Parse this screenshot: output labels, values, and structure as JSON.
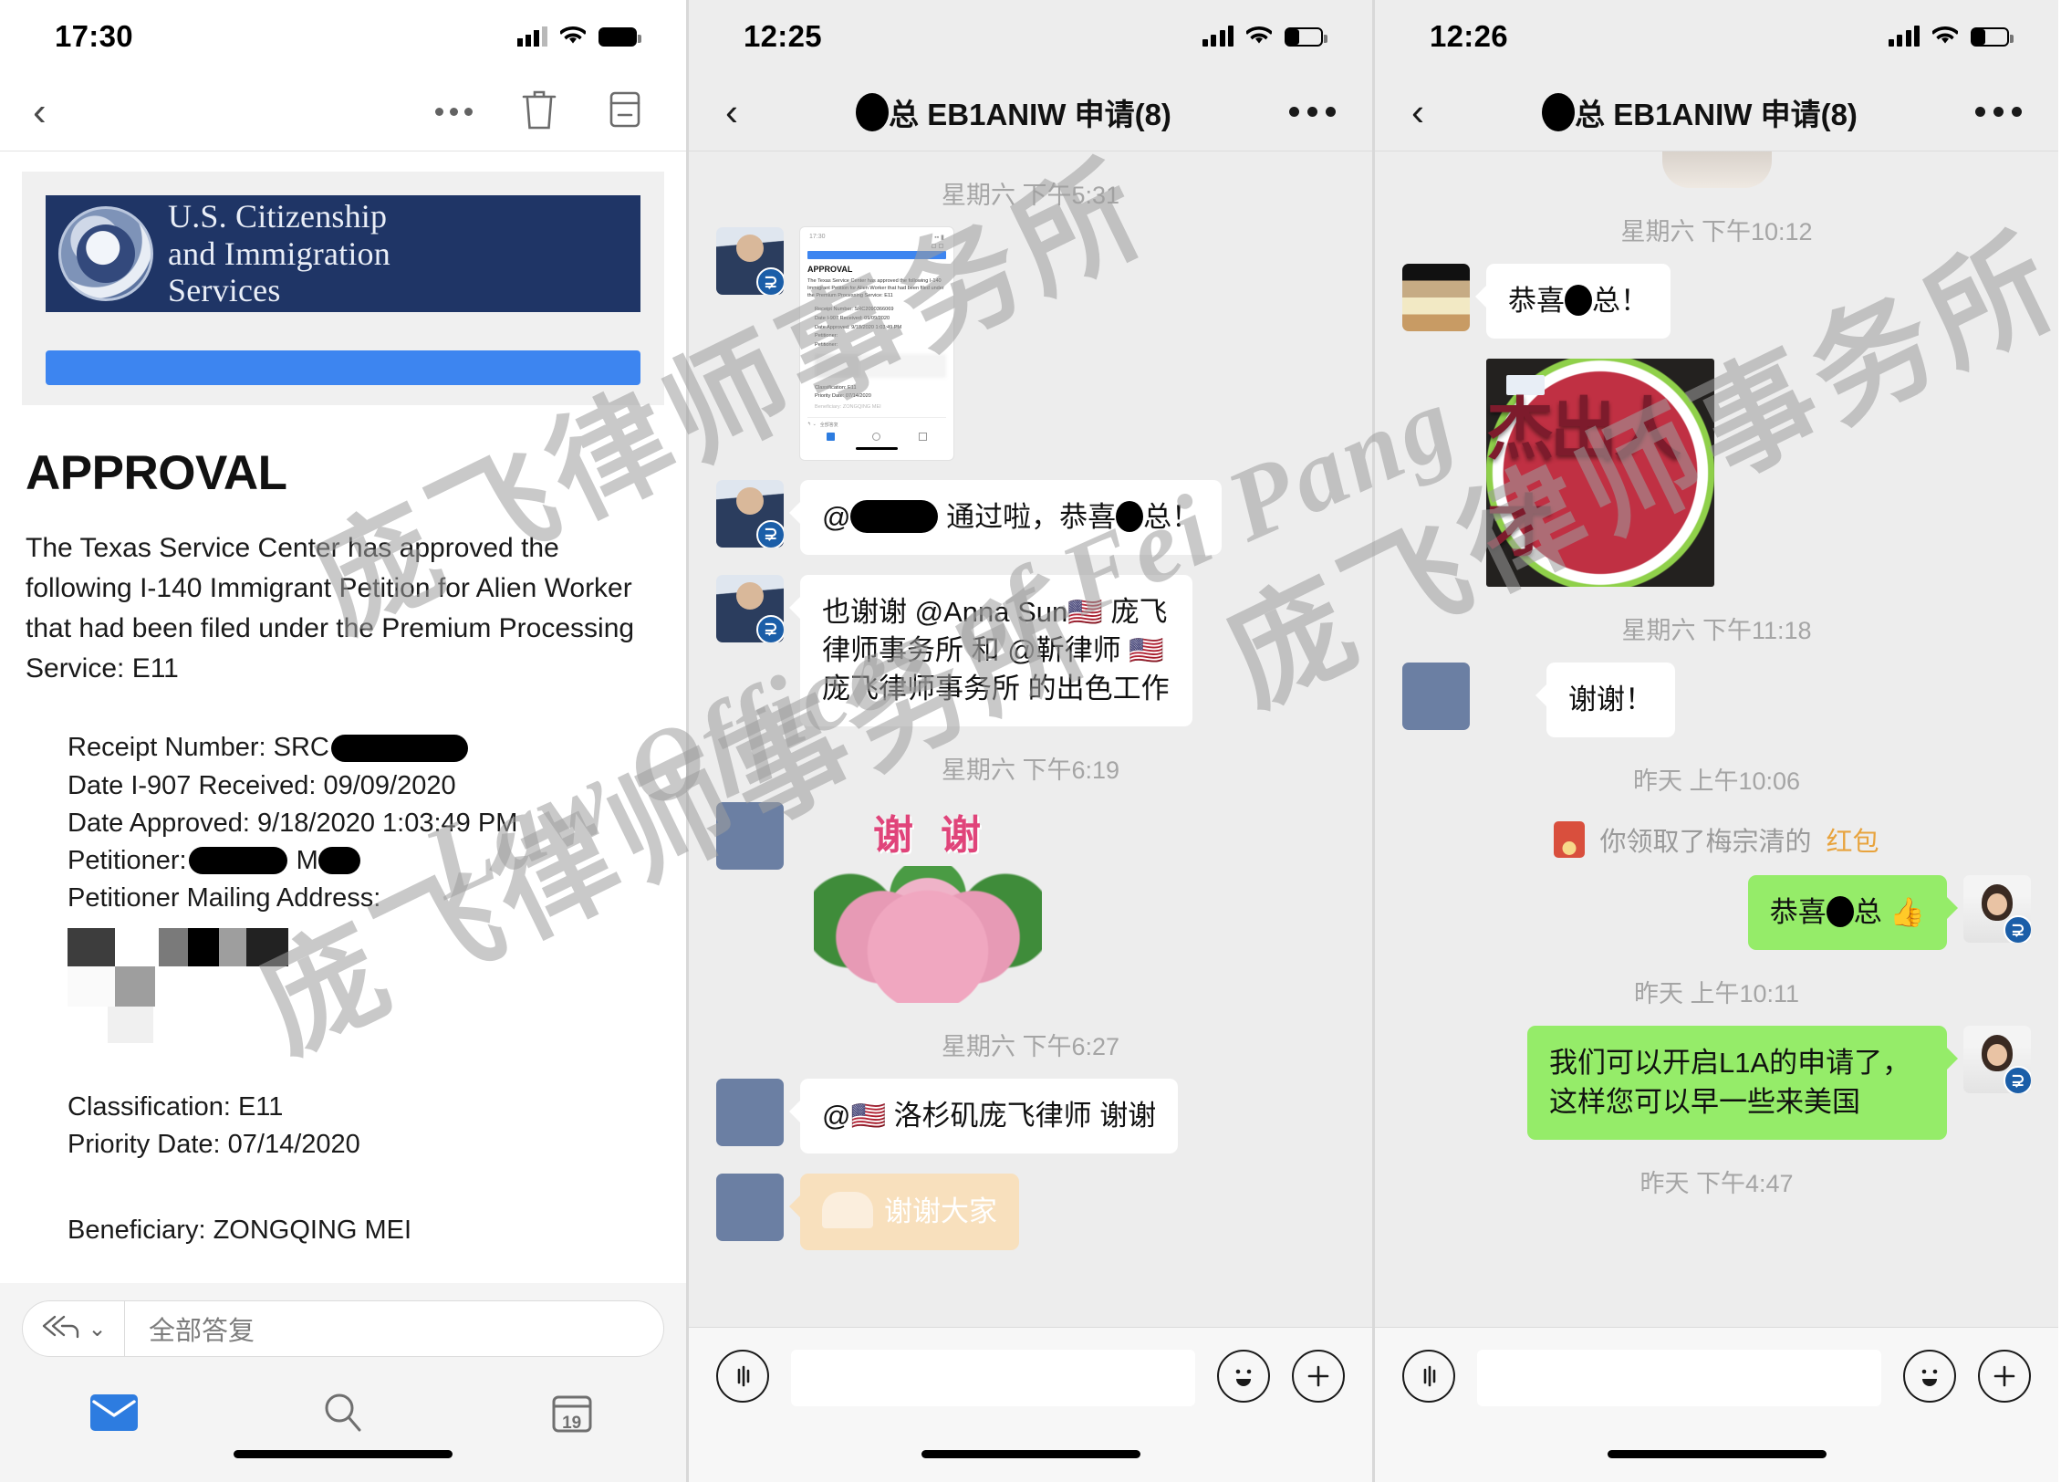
{
  "watermark": {
    "cn_text": "庞飞律师事务所",
    "en_text": "Law Offices of Fei Pang",
    "color": "#9e9e9e"
  },
  "left_panel": {
    "name": "mail-app",
    "status_bar": {
      "time": "17:30",
      "signal": "signal-dots-icon",
      "wifi": "wifi-icon",
      "battery": "battery-full-icon"
    },
    "toolbar": {
      "back": "‹",
      "more_label": "more-options",
      "delete_label": "delete",
      "archive_label": "archive"
    },
    "email": {
      "logo_line1": "U.S. Citizenship",
      "logo_line2": "and Immigration",
      "logo_line3": "Services",
      "heading": "APPROVAL",
      "paragraph": "The Texas Service Center has approved the following I-140 Immigrant Petition for Alien Worker that had been filed under the Premium Processing Service: E11",
      "fields": [
        {
          "label": "Receipt Number: SRC",
          "value": "",
          "redacted": true
        },
        {
          "label": "Date I-907 Received: 09/09/2020",
          "value": "",
          "redacted": false
        },
        {
          "label": "Date Approved: 9/18/2020 1:03:49 PM",
          "value": "",
          "redacted": false
        },
        {
          "label": "Petitioner:",
          "value": "M",
          "redacted": true
        },
        {
          "label": "Petitioner Mailing Address:",
          "value": "",
          "redacted": true
        }
      ],
      "classification": "Classification: E11",
      "priority_date": "Priority Date: 07/14/2020",
      "beneficiary": "Beneficiary: ZONGQING MEI"
    },
    "reply": {
      "icon": "reply-all-icon",
      "chevron": "chevron-down-icon",
      "placeholder": "全部答复"
    },
    "tabs": [
      {
        "name": "mail-tab",
        "icon": "envelope-icon",
        "active": true
      },
      {
        "name": "search-tab",
        "icon": "search-icon",
        "active": false
      },
      {
        "name": "calendar-tab",
        "icon": "calendar-icon",
        "label": "19",
        "active": false
      }
    ]
  },
  "middle_panel": {
    "name": "wechat-chat-1225",
    "status_bar": {
      "time": "12:25",
      "signal": "signal-bars-icon",
      "wifi": "wifi-icon",
      "battery": "battery-low-icon"
    },
    "nav": {
      "back": "‹",
      "title_prefix": "",
      "title": "总 EB1ANIW 申请(8)",
      "more": "more-options-icon"
    },
    "messages": [
      {
        "type": "timestamp",
        "text": "星期六 下午5:31"
      },
      {
        "type": "image-card",
        "sender": "man",
        "card": {
          "status_time": "17:30",
          "heading": "APPROVAL",
          "paragraph": "The Texas Service Center has approved the following I-140 Immigrant Petition for Alien Worker that had been filed under the Premium Processing Service: E11",
          "f1": "Receipt Number: SRC2090366069",
          "f2": "Date I-907 Received: 09/09/2020",
          "f3": "Date Approved: 9/18/2020 1:03:49 PM",
          "f4": "Petitioner:",
          "f5": "Petitioner:",
          "f6": "Classification: E11",
          "f7": "Priority Date: 07/14/2020",
          "f8": "Beneficiary: ZONGQING MEI",
          "reply_placeholder": "全部答复"
        }
      },
      {
        "type": "text",
        "side": "in",
        "sender": "man",
        "text_a": "@",
        "text_b": " 通过啦，恭喜",
        "text_c": "总！"
      },
      {
        "type": "text",
        "side": "in",
        "sender": "man",
        "text": "也谢谢 @Anna Sun🇺🇸 庞飞律师事务所 和 @靳律师 🇺🇸 庞飞律师事务所 的出色工作"
      },
      {
        "type": "timestamp",
        "text": "星期六 下午6:19"
      },
      {
        "type": "sticker",
        "sender": "blue",
        "sticker_text_1": "谢",
        "sticker_text_2": "谢",
        "sticker_name": "roses-thank-you-sticker"
      },
      {
        "type": "timestamp",
        "text": "星期六 下午6:27"
      },
      {
        "type": "text",
        "side": "in",
        "sender": "blue",
        "text": "@🇺🇸 洛杉矶庞飞律师 谢谢"
      },
      {
        "type": "text",
        "side": "in",
        "sender": "blue",
        "variant": "orange",
        "text": "谢谢大家"
      }
    ],
    "input_bar": {
      "voice_icon": "voice-icon",
      "emoji_icon": "emoji-icon",
      "plus_icon": "plus-icon",
      "value": ""
    }
  },
  "right_panel": {
    "name": "wechat-chat-1226",
    "status_bar": {
      "time": "12:26",
      "signal": "signal-bars-icon",
      "wifi": "wifi-icon",
      "battery": "battery-low-icon"
    },
    "nav": {
      "back": "‹",
      "title": "总 EB1ANIW 申请(8)",
      "more": "more-options-icon"
    },
    "messages": [
      {
        "type": "timestamp",
        "text": "星期六 下午10:12"
      },
      {
        "type": "text",
        "side": "in",
        "sender": "stripes",
        "text_a": "恭喜",
        "text_b": "总！"
      },
      {
        "type": "image",
        "sender": "stripes",
        "image_name": "carved-watermelon-photo",
        "carved_text": "杰出人才"
      },
      {
        "type": "timestamp",
        "text": "星期六 下午11:18"
      },
      {
        "type": "text",
        "side": "in",
        "sender": "blue",
        "text": "谢谢！"
      },
      {
        "type": "timestamp",
        "text": "昨天 上午10:06"
      },
      {
        "type": "system",
        "icon": "red-packet-icon",
        "text_a": "你领取了梅宗清的",
        "text_b": "红包"
      },
      {
        "type": "text",
        "side": "out",
        "sender": "woman",
        "text_a": "恭喜",
        "text_b": "总 👍"
      },
      {
        "type": "timestamp",
        "text": "昨天 上午10:11"
      },
      {
        "type": "text",
        "side": "out",
        "sender": "woman",
        "text": "我们可以开启L1A的申请了，这样您可以早一些来美国"
      },
      {
        "type": "timestamp",
        "text": "昨天 下午4:47"
      }
    ],
    "input_bar": {
      "voice_icon": "voice-icon",
      "emoji_icon": "emoji-icon",
      "plus_icon": "plus-icon",
      "value": ""
    }
  },
  "colors": {
    "wechat_green": "#95ec69",
    "dhs_navy": "#1f3566",
    "accent_blue": "#3d85f0",
    "red_packet": "#d94f3d",
    "link_orange": "#e8a33d"
  }
}
